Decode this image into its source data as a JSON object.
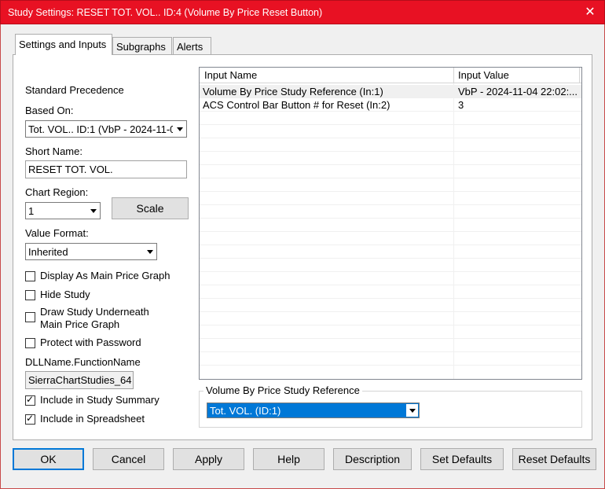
{
  "window": {
    "title": "Study Settings: RESET TOT. VOL.. ID:4 (Volume By Price Reset Button)",
    "close_glyph": "✕"
  },
  "tabs": [
    {
      "label": "Settings and Inputs"
    },
    {
      "label": "Subgraphs"
    },
    {
      "label": "Alerts"
    }
  ],
  "left": {
    "standard_precedence": "Standard Precedence",
    "based_on_label": "Based On:",
    "based_on_value": "Tot. VOL.. ID:1 (VbP - 2024-11-0",
    "short_name_label": "Short Name:",
    "short_name_value": "RESET TOT. VOL.",
    "chart_region_label": "Chart Region:",
    "chart_region_value": "1",
    "scale_button": "Scale",
    "value_format_label": "Value Format:",
    "value_format_value": "Inherited",
    "display_main": "Display As Main Price Graph",
    "hide_study": "Hide Study",
    "draw_underneath_1": "Draw Study Underneath",
    "draw_underneath_2": "Main Price Graph",
    "protect_password": "Protect with Password",
    "dll_label": "DLLName.FunctionName",
    "dll_value": "SierraChartStudies_64",
    "include_summary": "Include in Study Summary",
    "include_spreadsheet": "Include in Spreadsheet"
  },
  "inputs_table": {
    "headers": [
      "Input Name",
      "Input Value"
    ],
    "rows": [
      {
        "name": "Volume By Price Study Reference  (In:1)",
        "value": "VbP - 2024-11-04  22:02:..."
      },
      {
        "name": "ACS Control Bar Button # for Reset  (In:2)",
        "value": "3"
      }
    ]
  },
  "reference_group": {
    "legend": "Volume By Price Study Reference",
    "value": "Tot. VOL. (ID:1)"
  },
  "buttons": {
    "ok": "OK",
    "cancel": "Cancel",
    "apply": "Apply",
    "help": "Help",
    "description": "Description",
    "set_defaults": "Set Defaults",
    "reset_defaults": "Reset Defaults"
  },
  "colors": {
    "titlebar": "#e81123",
    "selection": "#0078d7"
  }
}
